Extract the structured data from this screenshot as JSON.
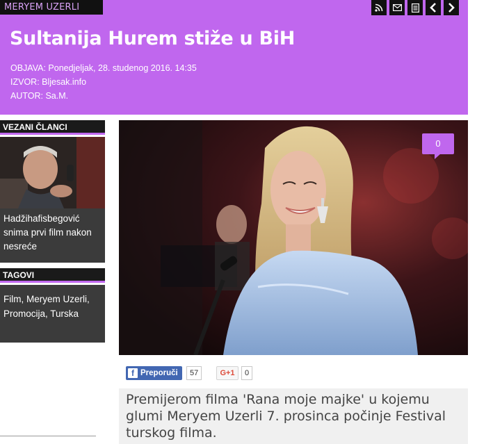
{
  "category": "MERYEM UZERLI",
  "toolbar": {
    "icons": [
      "rss-icon",
      "mail-icon",
      "print-icon",
      "prev-arrow-icon",
      "next-arrow-icon"
    ]
  },
  "article": {
    "title": "Sultanija Hurem stiže u BiH",
    "published": "OBJAVA: Ponedjeljak, 28. studenog 2016. 14:35",
    "source": "IZVOR: Bljesak.info",
    "author": "AUTOR: Sa.M.",
    "comment_count": "0",
    "lead": "Premijerom filma 'Rana moje majke' u kojemu glumi Meryem Uzerli 7. prosinca počinje Festival turskog filma."
  },
  "sidebar": {
    "related_title": "VEZANI ČLANCI",
    "related_item": "Hadžihafisbegović snima prvi film nakon nesreće",
    "tags_title": "TAGOVI",
    "tags_text": "Film, Meryem Uzerli, Promocija, Turska"
  },
  "share": {
    "facebook_label": "Preporuči",
    "facebook_count": "57",
    "gplus_label": "G+1",
    "gplus_count": "0"
  },
  "colors": {
    "accent": "#c067ee",
    "dark": "#1a1a1a",
    "sidebar_bg": "#3b3b3b"
  }
}
